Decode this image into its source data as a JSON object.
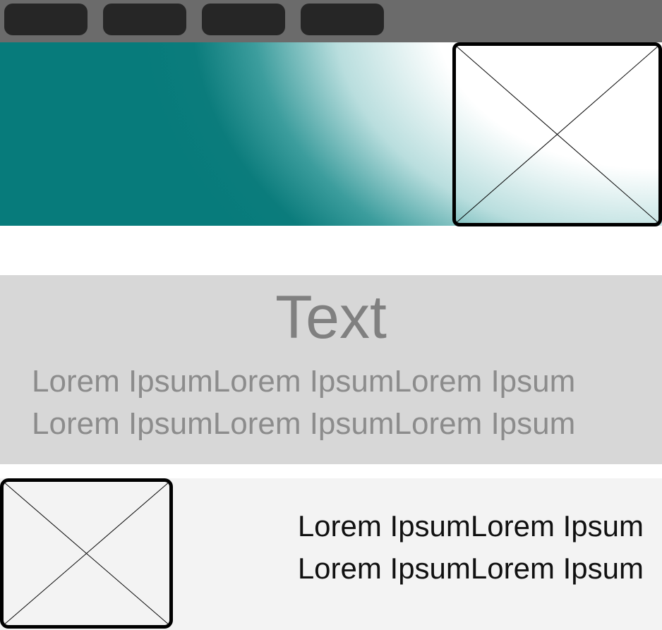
{
  "nav": {
    "buttons": [
      {
        "label": ""
      },
      {
        "label": ""
      },
      {
        "label": ""
      },
      {
        "label": ""
      }
    ]
  },
  "colors": {
    "topbar": "#6b6b6b",
    "nav_button": "#262626",
    "hero_teal": "#077b7b",
    "text_section_bg": "#d7d7d7",
    "bottom_section_bg": "#f3f3f3"
  },
  "text_section": {
    "title": "Text",
    "lines": [
      "Lorem IpsumLorem IpsumLorem Ipsum",
      "Lorem IpsumLorem IpsumLorem Ipsum"
    ]
  },
  "bottom_section": {
    "lines": [
      "Lorem IpsumLorem Ipsum",
      "Lorem IpsumLorem Ipsum"
    ]
  }
}
